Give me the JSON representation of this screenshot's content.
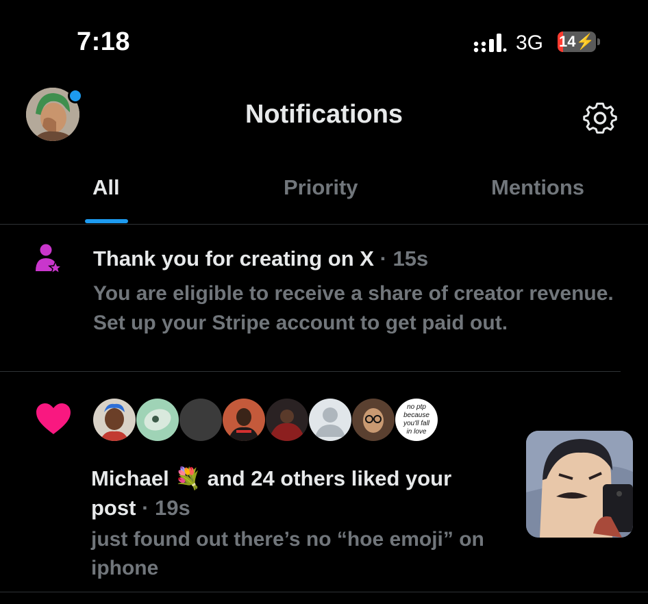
{
  "status_bar": {
    "time": "7:18",
    "network": "3G",
    "battery": "14",
    "battery_percent": 14,
    "battery_charging": true
  },
  "header": {
    "title": "Notifications",
    "settings_icon": "gear-icon",
    "has_unread_dot": true
  },
  "tabs": [
    {
      "label": "All",
      "active": true
    },
    {
      "label": "Priority",
      "active": false
    },
    {
      "label": "Mentions",
      "active": false
    }
  ],
  "notifications": [
    {
      "icon": "creator-person-star-icon",
      "title": "Thank you for creating on X",
      "time": "· 15s",
      "body": "You are eligible to receive a share of creator revenue. Set up your Stripe account to get paid out."
    },
    {
      "icon": "heart-icon",
      "actor": "Michael",
      "actor_emoji": "💐",
      "action": "and 24 others liked your post",
      "time": "· 19s",
      "post_text": "just found out there’s no “hoe emoji” on iphone",
      "face_sticker_text": "no ptp because you'll fall in love",
      "liker_count_shown": 8
    }
  ],
  "colors": {
    "background": "#000000",
    "text_primary": "#e7e9ea",
    "text_secondary": "#71767b",
    "accent": "#1d9bf0",
    "heart": "#f91880",
    "creator_icon": "#c936cc",
    "divider": "#2f3336"
  }
}
